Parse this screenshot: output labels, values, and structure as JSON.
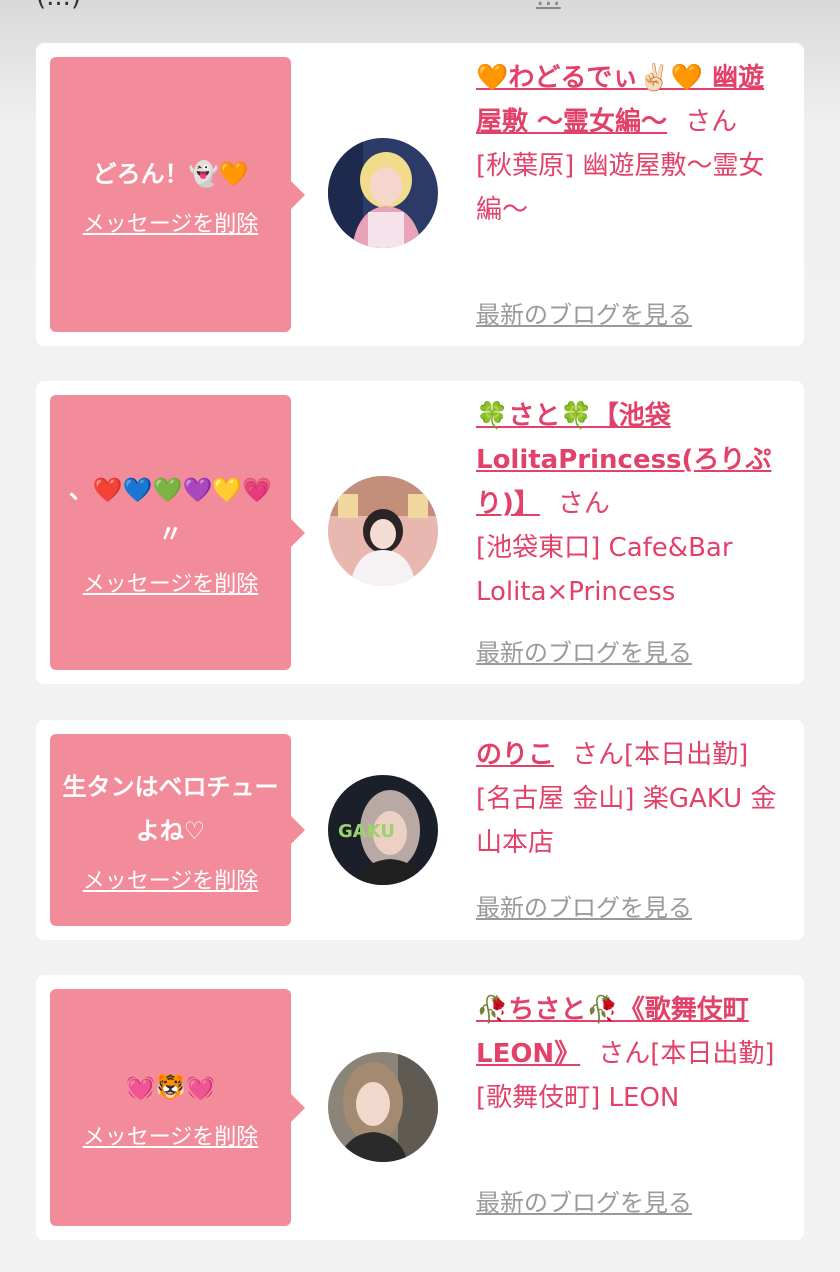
{
  "header": {
    "partial_left": "(...)",
    "partial_right": "..."
  },
  "common": {
    "delete_label": "メッセージを削除",
    "blog_label": "最新のブログを見る",
    "san": "さん"
  },
  "cards": [
    {
      "message": "どろん！👻🧡",
      "name": "🧡わどるでぃ✌🏻🧡 幽遊屋敷 〜霊女編〜",
      "status": "",
      "shop": "[秋葉原] 幽遊屋敷〜霊女編〜"
    },
    {
      "message": "、❤️💙💚💜💛💗〃",
      "name": "🍀さと🍀【池袋LolitaPrincess(ろりぷり)】",
      "status": "",
      "shop": "[池袋東口] Cafe&Bar Lolita×Princess"
    },
    {
      "message": "生タンはベロチューよね♡",
      "name": "のりこ",
      "status": "[本日出勤]",
      "shop": "[名古屋 金山] 楽GAKU 金山本店"
    },
    {
      "message": "💓🐯💓",
      "name": "🥀ちさと🥀《歌舞伎町LEON》",
      "status": "[本日出勤]",
      "shop": "[歌舞伎町] LEON"
    }
  ],
  "colors": {
    "accent": "#e2416a",
    "bubble": "#f28c9a",
    "link_gray": "#9a9a9a"
  }
}
